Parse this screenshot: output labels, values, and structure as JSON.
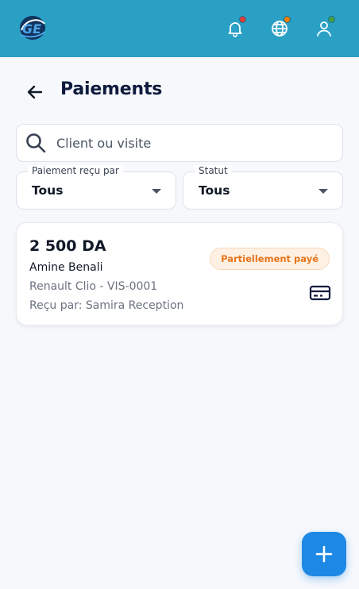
{
  "header": {
    "logo": "GE logo",
    "actions": [
      {
        "name": "notifications",
        "icon": "bell-icon",
        "dot_color": "#E53935"
      },
      {
        "name": "language",
        "icon": "globe-icon",
        "dot_color": "#F57C00"
      },
      {
        "name": "profile",
        "icon": "user-icon",
        "dot_color": "#43A047"
      }
    ],
    "background_color": "#2AA0C5"
  },
  "page": {
    "title": "Paiements",
    "back_icon": "arrow-left-icon"
  },
  "search": {
    "placeholder": "Client ou visite",
    "icon": "search-icon"
  },
  "filters": [
    {
      "label": "Paiement reçu par",
      "value": "Tous"
    },
    {
      "label": "Statut",
      "value": "Tous"
    }
  ],
  "payments": [
    {
      "amount": "2 500 DA",
      "client": "Amine Benali",
      "vehicle": "Renault Clio - VIS-0001",
      "received_by": "Reçu par: Samira Reception",
      "status": "Partiellement payé",
      "status_color": "#E8741A",
      "icon": "credit-card-icon"
    }
  ],
  "fab": {
    "icon": "plus-icon",
    "color": "#1E88E5"
  }
}
